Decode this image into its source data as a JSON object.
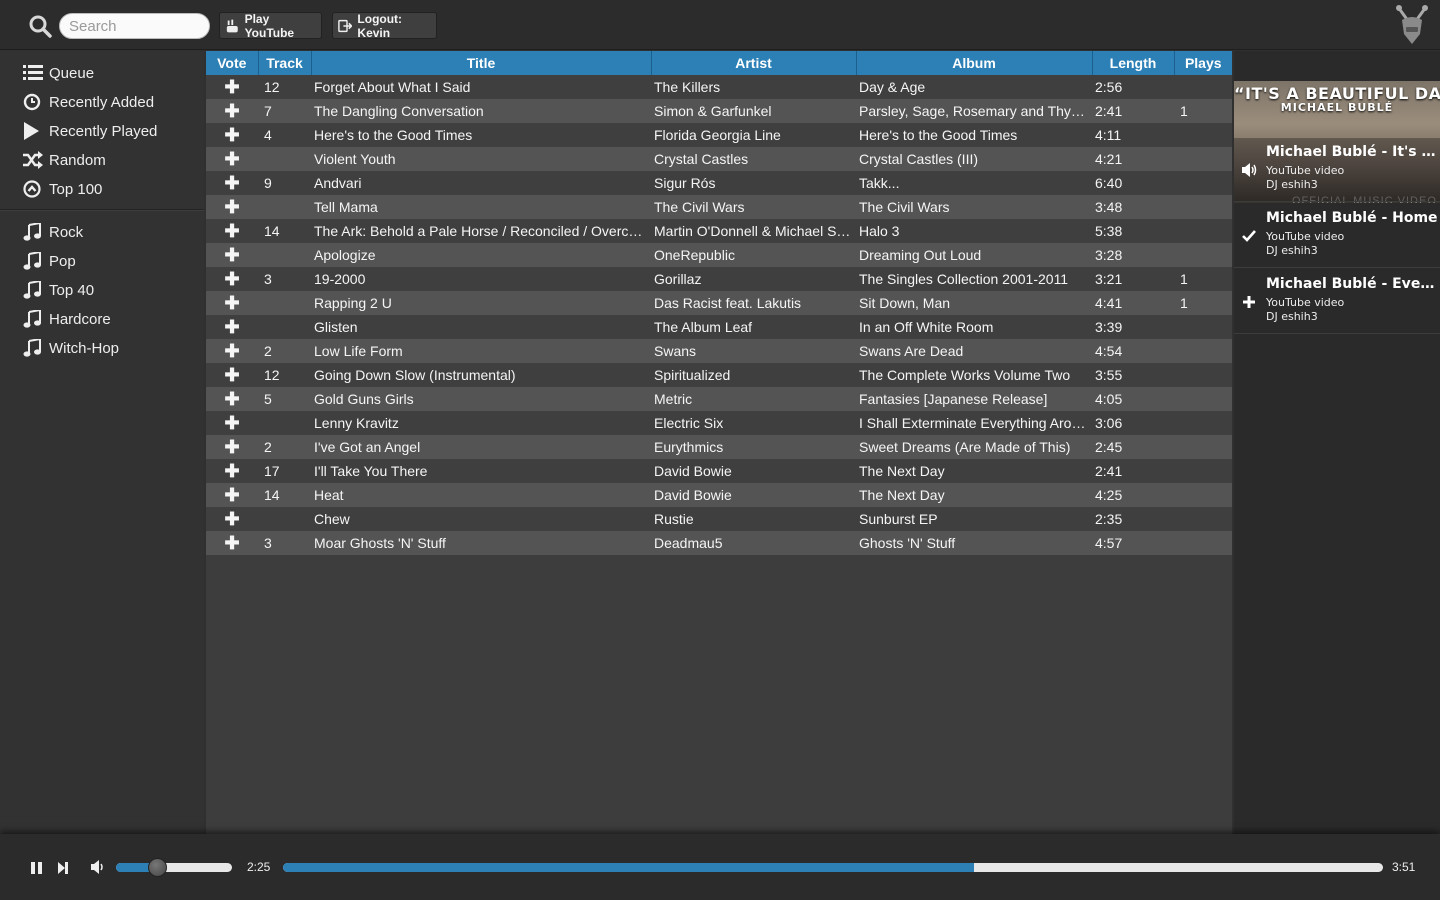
{
  "topbar": {
    "search_placeholder": "Search",
    "play_youtube_label": "Play YouTube",
    "logout_label": "Logout: Kevin"
  },
  "sidebar": {
    "nav": [
      {
        "label": "Queue",
        "icon": "list-icon"
      },
      {
        "label": "Recently Added",
        "icon": "clock-icon"
      },
      {
        "label": "Recently Played",
        "icon": "play-icon"
      },
      {
        "label": "Random",
        "icon": "shuffle-icon"
      },
      {
        "label": "Top 100",
        "icon": "chevron-up-circle-icon"
      }
    ],
    "genres": [
      {
        "label": "Rock",
        "icon": "music-note-icon"
      },
      {
        "label": "Pop",
        "icon": "music-note-icon"
      },
      {
        "label": "Top 40",
        "icon": "music-note-icon"
      },
      {
        "label": "Hardcore",
        "icon": "music-note-icon"
      },
      {
        "label": "Witch-Hop",
        "icon": "music-note-icon"
      }
    ]
  },
  "table": {
    "columns": [
      "Vote",
      "Track",
      "Title",
      "Artist",
      "Album",
      "Length",
      "Plays"
    ],
    "vote_symbol": "✚",
    "rows": [
      {
        "track": "12",
        "title": "Forget About What I Said",
        "artist": "The Killers",
        "album": "Day & Age",
        "length": "2:56",
        "plays": ""
      },
      {
        "track": "7",
        "title": "The Dangling Conversation",
        "artist": "Simon & Garfunkel",
        "album": "Parsley, Sage, Rosemary and Thyme",
        "length": "2:41",
        "plays": "1"
      },
      {
        "track": "4",
        "title": "Here's to the Good Times",
        "artist": "Florida Georgia Line",
        "album": "Here's to the Good Times",
        "length": "4:11",
        "plays": ""
      },
      {
        "track": "",
        "title": "Violent Youth",
        "artist": "Crystal Castles",
        "album": "Crystal Castles (III)",
        "length": "4:21",
        "plays": ""
      },
      {
        "track": "9",
        "title": "Andvari",
        "artist": "Sigur Rós",
        "album": "Takk...",
        "length": "6:40",
        "plays": ""
      },
      {
        "track": "",
        "title": "Tell Mama",
        "artist": "The Civil Wars",
        "album": "The Civil Wars",
        "length": "3:48",
        "plays": ""
      },
      {
        "track": "14",
        "title": "The Ark: Behold a Pale Horse / Reconciled / Overcome",
        "artist": "Martin O'Donnell & Michael Salvatori",
        "album": "Halo 3",
        "length": "5:38",
        "plays": ""
      },
      {
        "track": "",
        "title": "Apologize",
        "artist": "OneRepublic",
        "album": "Dreaming Out Loud",
        "length": "3:28",
        "plays": ""
      },
      {
        "track": "3",
        "title": "19-2000",
        "artist": "Gorillaz",
        "album": "The Singles Collection 2001-2011",
        "length": "3:21",
        "plays": "1"
      },
      {
        "track": "",
        "title": "Rapping 2 U",
        "artist": "Das Racist feat. Lakutis",
        "album": "Sit Down, Man",
        "length": "4:41",
        "plays": "1"
      },
      {
        "track": "",
        "title": "Glisten",
        "artist": "The Album Leaf",
        "album": "In an Off White Room",
        "length": "3:39",
        "plays": ""
      },
      {
        "track": "2",
        "title": "Low Life Form",
        "artist": "Swans",
        "album": "Swans Are Dead",
        "length": "4:54",
        "plays": ""
      },
      {
        "track": "12",
        "title": "Going Down Slow (Instrumental)",
        "artist": "Spiritualized",
        "album": "The Complete Works Volume Two",
        "length": "3:55",
        "plays": ""
      },
      {
        "track": "5",
        "title": "Gold Guns Girls",
        "artist": "Metric",
        "album": "Fantasies [Japanese Release]",
        "length": "4:05",
        "plays": ""
      },
      {
        "track": "",
        "title": "Lenny Kravitz",
        "artist": "Electric Six",
        "album": "I Shall Exterminate Everything Around Me",
        "length": "3:06",
        "plays": ""
      },
      {
        "track": "2",
        "title": "I've Got an Angel",
        "artist": "Eurythmics",
        "album": "Sweet Dreams (Are Made of This)",
        "length": "2:45",
        "plays": ""
      },
      {
        "track": "17",
        "title": "I'll Take You There",
        "artist": "David Bowie",
        "album": "The Next Day",
        "length": "2:41",
        "plays": ""
      },
      {
        "track": "14",
        "title": "Heat",
        "artist": "David Bowie",
        "album": "The Next Day",
        "length": "4:25",
        "plays": ""
      },
      {
        "track": "",
        "title": "Chew",
        "artist": "Rustie",
        "album": "Sunburst EP",
        "length": "2:35",
        "plays": ""
      },
      {
        "track": "3",
        "title": "Moar Ghosts 'N' Stuff",
        "artist": "Deadmau5",
        "album": "Ghosts 'N' Stuff",
        "length": "4:57",
        "plays": ""
      }
    ]
  },
  "queue_panel": {
    "now_playing_thumb": {
      "title_text": "“IT'S A BEAUTIFUL DAY”",
      "subtitle_text": "MICHAEL BUBLÉ",
      "caption_text": "OFFICIAL MUSIC VIDEO"
    },
    "items": [
      {
        "title": "Michael Bublé - It's A Beautiful Day",
        "type": "YouTube video",
        "dj": "DJ eshih3",
        "state_icon": "speaker-icon"
      },
      {
        "title": "Michael Bublé - Home",
        "type": "YouTube video",
        "dj": "DJ eshih3",
        "state_icon": "checkmark-icon"
      },
      {
        "title": "Michael Bublé - Everything",
        "type": "YouTube video",
        "dj": "DJ eshih3",
        "state_icon": "plus-icon"
      }
    ]
  },
  "player": {
    "elapsed": "2:25",
    "total": "3:51",
    "progress_fraction": 0.628,
    "volume_fraction": 0.36,
    "accent_color": "#2c80b6"
  }
}
